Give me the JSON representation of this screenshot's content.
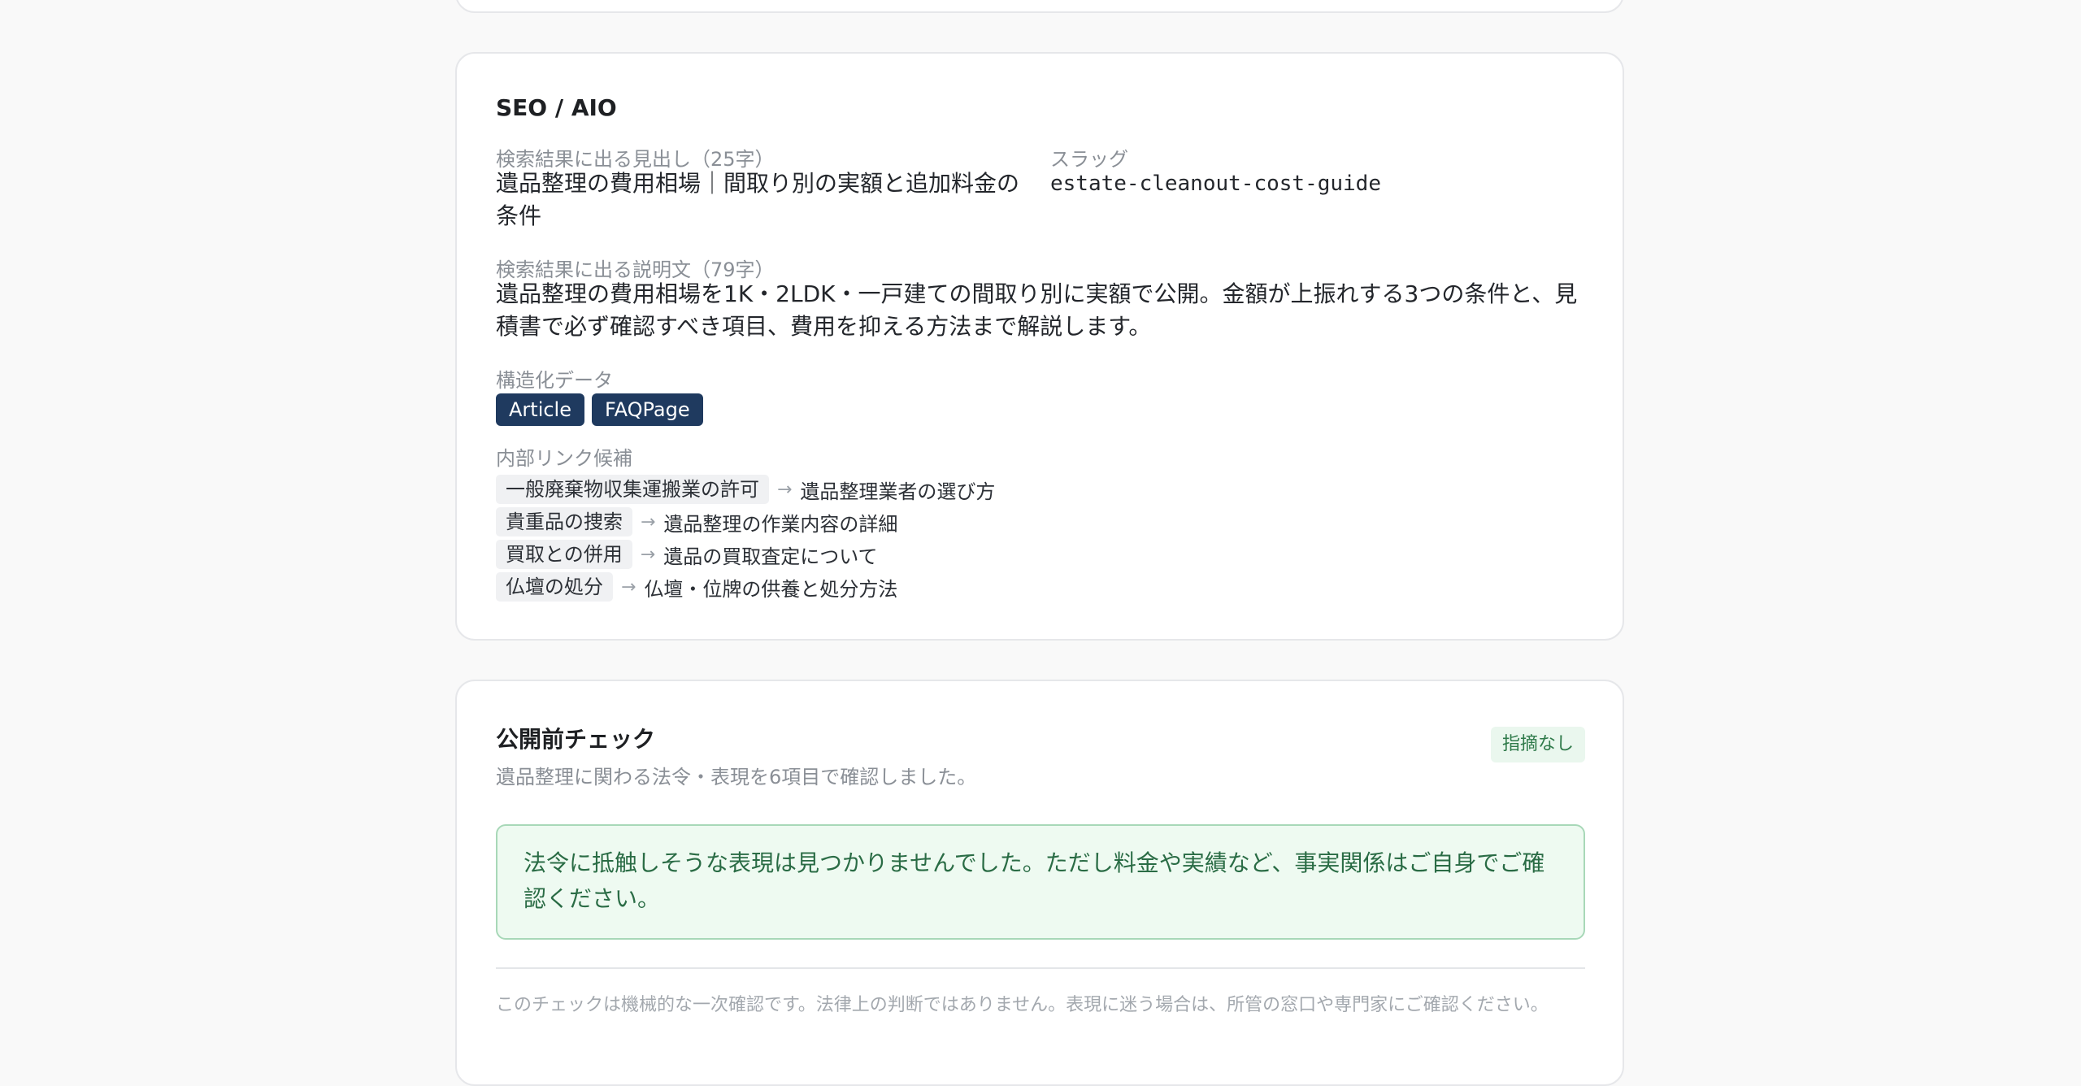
{
  "seo": {
    "title": "SEO / AIO",
    "headline_label": "検索結果に出る見出し（25字）",
    "headline_value": "遺品整理の費用相場｜間取り別の実額と追加料金の条件",
    "slug_label": "スラッグ",
    "slug_value": "estate-cleanout-cost-guide",
    "description_label": "検索結果に出る説明文（79字）",
    "description_value": "遺品整理の費用相場を1K・2LDK・一戸建ての間取り別に実額で公開。金額が上振れする3つの条件と、見積書で必ず確認すべき項目、費用を抑える方法まで解説します。",
    "structured_label": "構造化データ",
    "structured_tags": [
      "Article",
      "FAQPage"
    ],
    "internal_links_label": "内部リンク候補",
    "internal_links": [
      {
        "anchor": "一般廃棄物収集運搬業の許可",
        "target": "遺品整理業者の選び方"
      },
      {
        "anchor": "貴重品の捜索",
        "target": "遺品整理の作業内容の詳細"
      },
      {
        "anchor": "買取との併用",
        "target": "遺品の買取査定について"
      },
      {
        "anchor": "仏壇の処分",
        "target": "仏壇・位牌の供養と処分方法"
      }
    ],
    "arrow": "→"
  },
  "check": {
    "title": "公開前チェック",
    "subtitle": "遺品整理に関わる法令・表現を6項目で確認しました。",
    "badge": "指摘なし",
    "message": "法令に抵触しそうな表現は見つかりませんでした。ただし料金や実績など、事実関係はご自身でご確認ください。",
    "footnote": "このチェックは機械的な一次確認です。法律上の判断ではありません。表現に迷う場合は、所管の窓口や専門家にご確認ください。"
  },
  "colors": {
    "tag_bg": "#1f3a5f",
    "badge_bg": "#eaf7ee",
    "success_text": "#2a6c45",
    "alert_border": "#a8d8b8"
  }
}
